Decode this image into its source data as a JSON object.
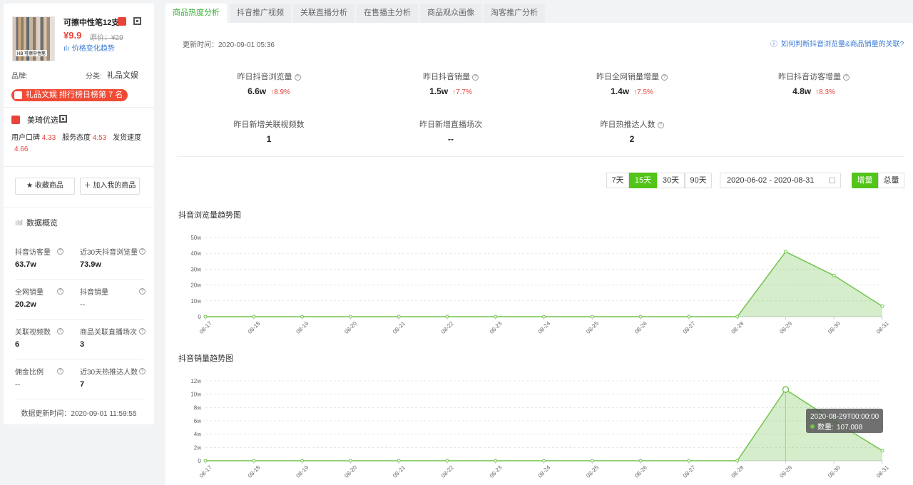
{
  "product": {
    "name": "可擦中性笔12支",
    "image_caption": "HB 可擦中性笔",
    "price": "¥9.9",
    "original_price": "原价：¥29",
    "price_trend_link": "价格变化趋势",
    "brand_label": "品牌:",
    "category_label": "分类:",
    "category_value": "礼品文娱",
    "rank_badge": "礼品文娱 排行榜日榜第 7 名"
  },
  "shop": {
    "name": "美琦优选",
    "rating_line1": "用户口碑",
    "rating_v1": "4.33",
    "rating_l2": "服务态度",
    "rating_v2": "4.53",
    "rating_l3": "发货速度",
    "rating_v3": "4.66"
  },
  "actions": {
    "favorite": "收藏商品",
    "add": "加入我的商品"
  },
  "overview": {
    "title": "数据概览",
    "items": [
      {
        "label": "抖音访客量",
        "value": "63.7w"
      },
      {
        "label": "近30天抖音浏览量",
        "value": "73.9w"
      },
      {
        "label": "全网销量",
        "value": "20.2w"
      },
      {
        "label": "抖音销量",
        "value": "--"
      },
      {
        "label": "关联视频数",
        "value": "6"
      },
      {
        "label": "商品关联直播场次",
        "value": "3"
      },
      {
        "label": "佣金比例",
        "value": "--"
      },
      {
        "label": "近30天热推达人数",
        "value": "7"
      }
    ],
    "updated": "数据更新时间：2020-09-01 11:59:55"
  },
  "tabs": [
    "商品热度分析",
    "抖音推广视频",
    "关联直播分析",
    "在售播主分析",
    "商品观众画像",
    "淘客推广分析"
  ],
  "main": {
    "update_time": "更新时间：2020-09-01 05:36",
    "help_link": "如何判断抖音浏览量&商品销量的关联?",
    "stats": [
      {
        "label": "昨日抖音浏览量",
        "value": "6.6w",
        "change": "↑8.9%"
      },
      {
        "label": "昨日抖音销量",
        "value": "1.5w",
        "change": "↑7.7%"
      },
      {
        "label": "昨日全网销量增量",
        "value": "1.4w",
        "change": "↑7.5%"
      },
      {
        "label": "昨日抖音访客增量",
        "value": "4.8w",
        "change": "↑8.3%"
      },
      {
        "label": "昨日新增关联视频数",
        "value": "1",
        "change": ""
      },
      {
        "label": "昨日新增直播场次",
        "value": "--",
        "change": ""
      },
      {
        "label": "昨日热推达人数",
        "value": "2",
        "change": ""
      }
    ],
    "ranges": [
      "7天",
      "15天",
      "30天",
      "90天"
    ],
    "date_range": "2020-06-02 - 2020-08-31",
    "modes": [
      "增量",
      "总量"
    ]
  },
  "chart_data": [
    {
      "type": "area",
      "title": "抖音浏览量趋势图",
      "categories": [
        "08-17",
        "08-18",
        "08-19",
        "08-20",
        "08-21",
        "08-22",
        "08-23",
        "08-24",
        "08-25",
        "08-26",
        "08-27",
        "08-28",
        "08-29",
        "08-30",
        "08-31"
      ],
      "y_ticks": [
        "0",
        "10w",
        "20w",
        "30w",
        "40w",
        "50w"
      ],
      "ylim": [
        0,
        500000
      ],
      "series": [
        {
          "values": [
            0,
            0,
            0,
            0,
            0,
            0,
            0,
            0,
            0,
            0,
            0,
            0,
            410000,
            260000,
            66000
          ]
        }
      ],
      "color": "#73c44f"
    },
    {
      "type": "area",
      "title": "抖音销量趋势图",
      "categories": [
        "08-17",
        "08-18",
        "08-19",
        "08-20",
        "08-21",
        "08-22",
        "08-23",
        "08-24",
        "08-25",
        "08-26",
        "08-27",
        "08-28",
        "08-29",
        "08-30",
        "08-31"
      ],
      "y_ticks": [
        "0",
        "2w",
        "4w",
        "6w",
        "8w",
        "10w",
        "12w"
      ],
      "ylim": [
        0,
        120000
      ],
      "series": [
        {
          "name": "数量",
          "values": [
            0,
            0,
            0,
            0,
            0,
            0,
            0,
            0,
            0,
            0,
            0,
            0,
            107008,
            60000,
            15000
          ]
        }
      ],
      "color": "#73c44f",
      "tooltip": {
        "title": "2020-08-29T00:00:00",
        "label": "数量:",
        "value": "107,008"
      }
    }
  ]
}
